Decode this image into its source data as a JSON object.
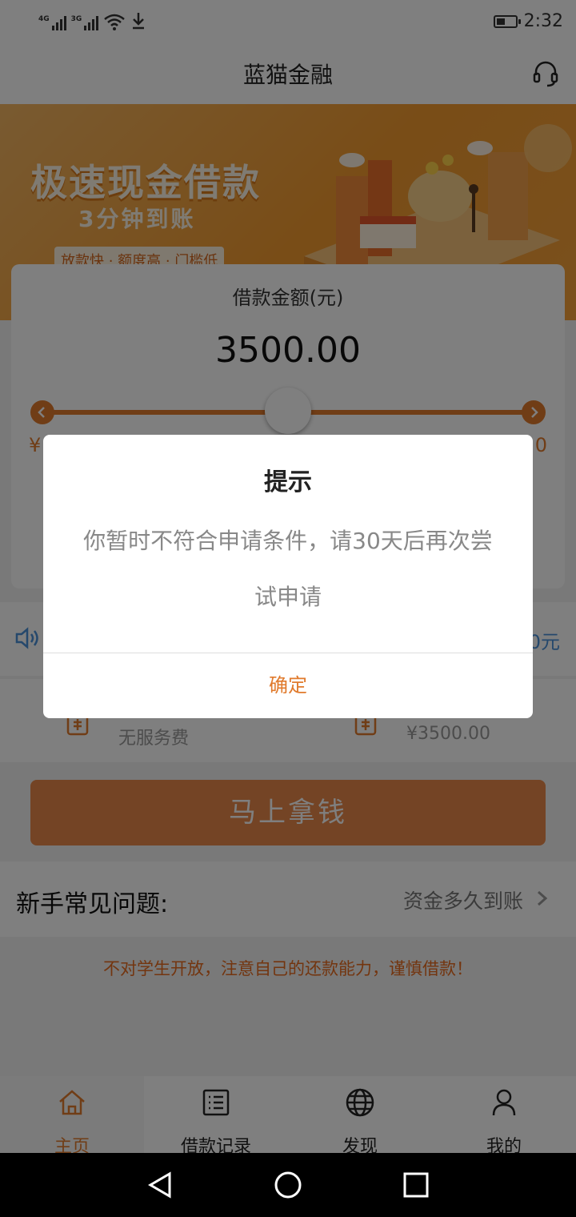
{
  "status_bar": {
    "network1": "4G",
    "network2": "3G",
    "time": "2:32",
    "battery_level": 0.45
  },
  "header": {
    "title": "蓝猫金融"
  },
  "banner": {
    "title": "极速现金借款",
    "subtitle": "3分钟到账",
    "tagline": "放款快 · 额度高 · 门槛低"
  },
  "loan": {
    "amount_label": "借款金额(元)",
    "amount_value": "3500.00",
    "range_min_visible": "¥",
    "range_max_visible": "0",
    "slider_position": 0.5
  },
  "notice": {
    "tail_text": "0元"
  },
  "fees": {
    "left_text": "无服务费",
    "right_text": "¥3500.00"
  },
  "cta_label": "马上拿钱",
  "faq": {
    "title": "新手常见问题:",
    "link": "资金多久到账"
  },
  "warning": "不对学生开放，注意自己的还款能力，谨慎借款！",
  "tabs": [
    {
      "label": "主页",
      "icon": "home-icon"
    },
    {
      "label": "借款记录",
      "icon": "list-icon"
    },
    {
      "label": "发现",
      "icon": "globe-icon"
    },
    {
      "label": "我的",
      "icon": "user-icon"
    }
  ],
  "dialog": {
    "title": "提示",
    "message": "你暂时不符合申请条件，请30天后再次尝试申请",
    "confirm": "确定"
  },
  "colors": {
    "accent": "#e07a2c",
    "banner": "#f29a2e",
    "overlay": "rgba(0,0,0,0.5)"
  }
}
